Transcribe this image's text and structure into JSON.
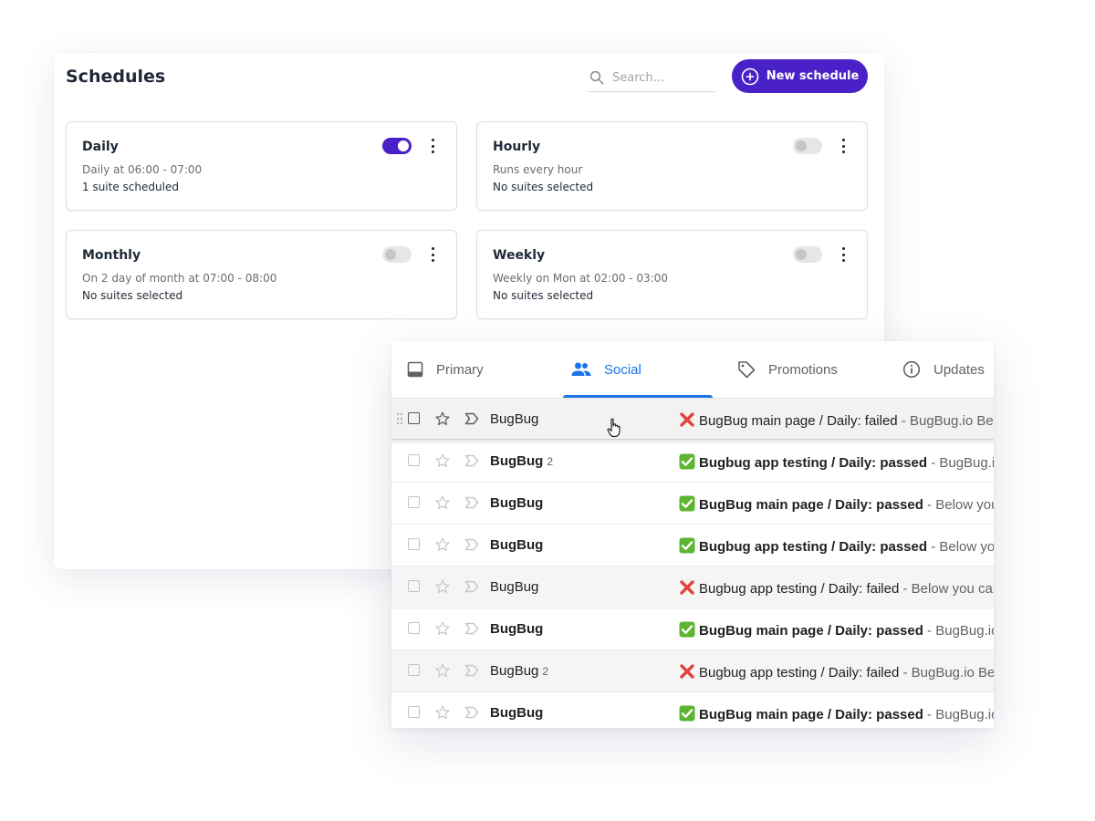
{
  "schedules": {
    "title": "Schedules",
    "search_placeholder": "Search...",
    "new_button": "New schedule",
    "accent": "#4a21c9",
    "cards": [
      {
        "name": "Daily",
        "description": "Daily at 06:00 - 07:00",
        "suites": "1 suite scheduled",
        "enabled": true
      },
      {
        "name": "Hourly",
        "description": "Runs every hour",
        "suites": "No suites selected",
        "enabled": false
      },
      {
        "name": "Monthly",
        "description": "On 2 day of month at 07:00 - 08:00",
        "suites": "No suites selected",
        "enabled": false
      },
      {
        "name": "Weekly",
        "description": "Weekly on Mon at 02:00 - 03:00",
        "suites": "No suites selected",
        "enabled": false
      }
    ]
  },
  "mail": {
    "tabs": [
      {
        "label": "Primary",
        "icon": "inbox-icon",
        "active": false
      },
      {
        "label": "Social",
        "icon": "people-icon",
        "active": true
      },
      {
        "label": "Promotions",
        "icon": "tag-icon",
        "active": false
      },
      {
        "label": "Updates",
        "icon": "info-icon",
        "active": false
      }
    ],
    "active_color": "#1a73e8",
    "rows": [
      {
        "sender": "BugBug",
        "count": "",
        "status": "failed",
        "subject": "BugBug main page / Daily: failed",
        "snippet": " - BugBug.io Below you can see the results",
        "unread": false
      },
      {
        "sender": "BugBug",
        "count": "2",
        "status": "passed",
        "subject": "Bugbug app testing / Daily: passed",
        "snippet": " - BugBug.io Below you can see",
        "unread": true
      },
      {
        "sender": "BugBug",
        "count": "",
        "status": "passed",
        "subject": "BugBug main page / Daily: passed",
        "snippet": " - Below you can see the results",
        "unread": true
      },
      {
        "sender": "BugBug",
        "count": "",
        "status": "passed",
        "subject": "Bugbug app testing / Daily: passed",
        "snippet": " - Below you can see the results",
        "unread": true
      },
      {
        "sender": "BugBug",
        "count": "",
        "status": "failed",
        "subject": "Bugbug app testing / Daily: failed",
        "snippet": " - Below you can see the results",
        "unread": false
      },
      {
        "sender": "BugBug",
        "count": "",
        "status": "passed",
        "subject": "BugBug main page / Daily: passed",
        "snippet": " - BugBug.io Below you can see",
        "unread": true
      },
      {
        "sender": "BugBug",
        "count": "2",
        "status": "failed",
        "subject": "Bugbug app testing / Daily: failed",
        "snippet": " - BugBug.io Below you can see",
        "unread": false
      },
      {
        "sender": "BugBug",
        "count": "",
        "status": "passed",
        "subject": "BugBug main page / Daily: passed",
        "snippet": " - BugBug.io Below you can see",
        "unread": true
      }
    ]
  }
}
